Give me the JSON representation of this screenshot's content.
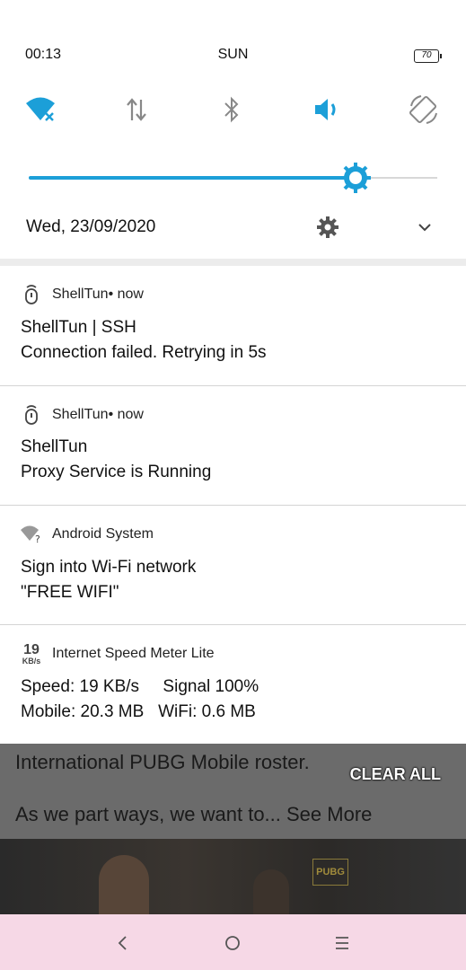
{
  "status_bar": {
    "time": "00:13",
    "day": "SUN",
    "battery": "70"
  },
  "quick_settings": {
    "toggles": [
      "wifi-off-icon",
      "mobile-data-icon",
      "bluetooth-icon",
      "volume-icon",
      "auto-rotate-icon"
    ],
    "accent_color": "#1c9fd8",
    "brightness_level": 0.8
  },
  "date_row": {
    "date": "Wed, 23/09/2020"
  },
  "notifications": [
    {
      "app": "ShellTun",
      "time": " • now",
      "line1": "ShellTun | SSH",
      "line2": "Connection failed. Retrying in 5s"
    },
    {
      "app": "ShellTun",
      "time": " • now",
      "line1": "ShellTun",
      "line2": "Proxy Service is Running"
    },
    {
      "app": "Android System",
      "time": "",
      "line1": "Sign into Wi-Fi network",
      "line2": "\"FREE WIFI\""
    },
    {
      "app": "Internet Speed Meter Lite",
      "time": "",
      "icon_value": "19",
      "icon_unit": "KB/s",
      "line1": "Speed: 19 KB/s     Signal 100%",
      "line2": "Mobile: 20.3 MB   WiFi: 0.6 MB"
    }
  ],
  "background_app": {
    "line1": "International PUBG Mobile roster.",
    "line2": "As we part ways, we want to... See More",
    "badge": "PUBG"
  },
  "clear_all": "CLEAR ALL"
}
